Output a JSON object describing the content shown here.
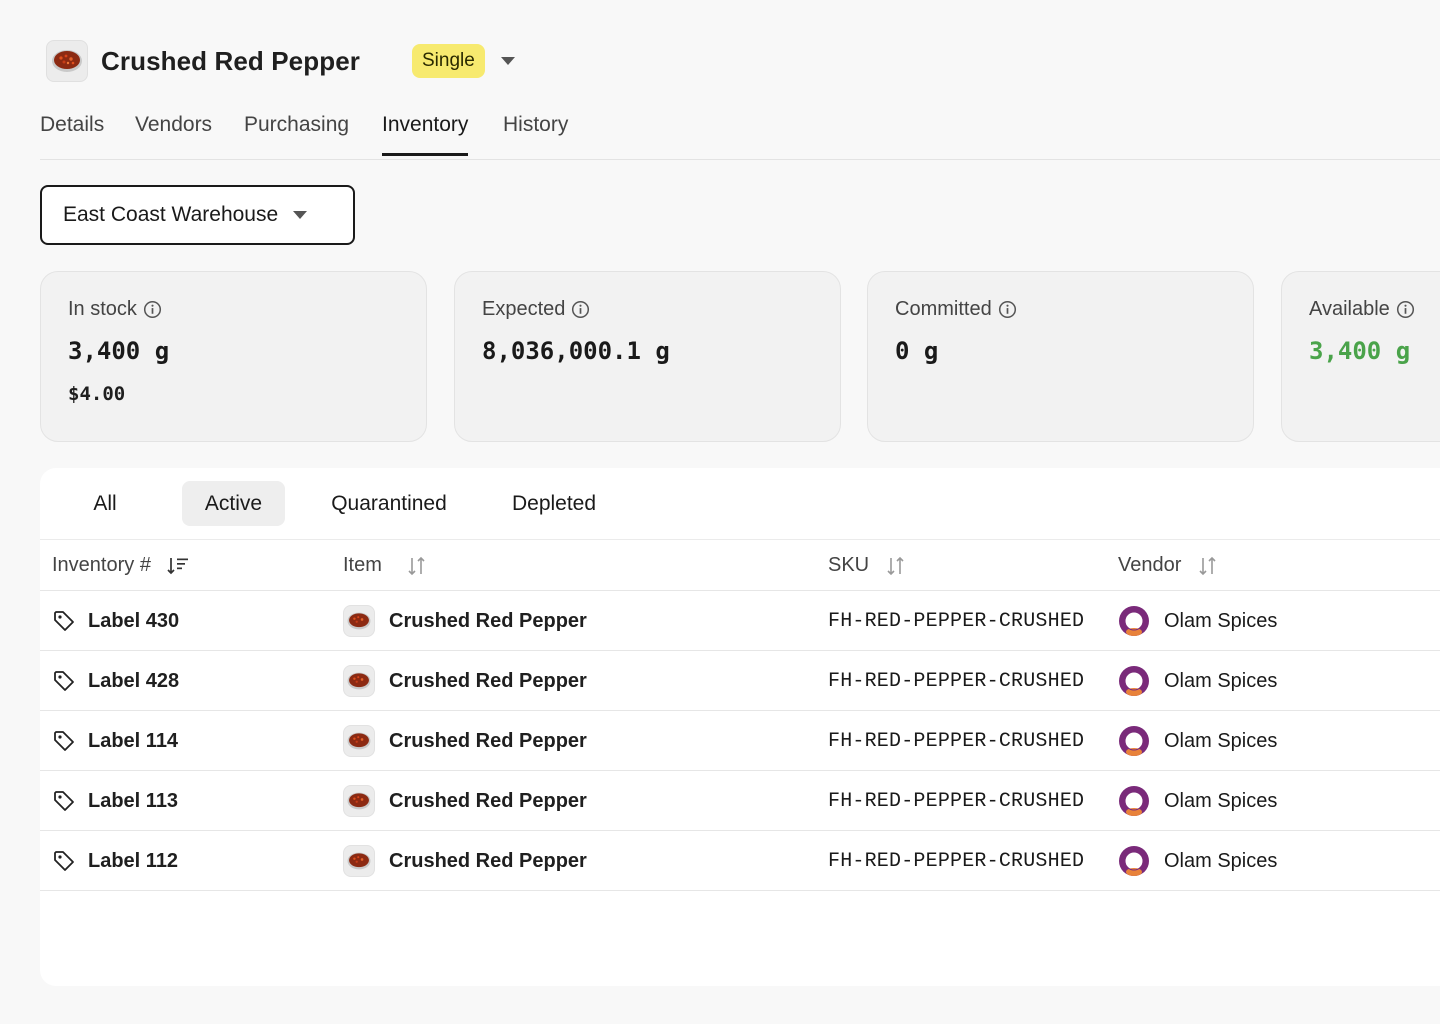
{
  "header": {
    "title": "Crushed Red Pepper",
    "badge": "Single",
    "thumb_icon": "red-pepper-bowl-icon"
  },
  "tabs": [
    {
      "label": "Details",
      "active": false
    },
    {
      "label": "Vendors",
      "active": false
    },
    {
      "label": "Purchasing",
      "active": false
    },
    {
      "label": "Inventory",
      "active": true
    },
    {
      "label": "History",
      "active": false
    }
  ],
  "location": {
    "selected": "East Coast Warehouse"
  },
  "stats": [
    {
      "label": "In stock",
      "value": "3,400 g",
      "sub": "$4.00"
    },
    {
      "label": "Expected",
      "value": "8,036,000.1 g"
    },
    {
      "label": "Committed",
      "value": "0 g"
    },
    {
      "label": "Available",
      "value": "3,400 g",
      "color": "#4aa34a"
    }
  ],
  "filters": [
    {
      "label": "All",
      "active": false
    },
    {
      "label": "Active",
      "active": true
    },
    {
      "label": "Quarantined",
      "active": false
    },
    {
      "label": "Depleted",
      "active": false
    }
  ],
  "columns": {
    "inventory": "Inventory #",
    "item": "Item",
    "sku": "SKU",
    "vendor": "Vendor"
  },
  "rows": [
    {
      "label": "Label 430",
      "item": "Crushed Red Pepper",
      "sku": "FH-RED-PEPPER-CRUSHED",
      "vendor": "Olam Spices"
    },
    {
      "label": "Label 428",
      "item": "Crushed Red Pepper",
      "sku": "FH-RED-PEPPER-CRUSHED",
      "vendor": "Olam Spices"
    },
    {
      "label": "Label 114",
      "item": "Crushed Red Pepper",
      "sku": "FH-RED-PEPPER-CRUSHED",
      "vendor": "Olam Spices"
    },
    {
      "label": "Label 113",
      "item": "Crushed Red Pepper",
      "sku": "FH-RED-PEPPER-CRUSHED",
      "vendor": "Olam Spices"
    },
    {
      "label": "Label 112",
      "item": "Crushed Red Pepper",
      "sku": "FH-RED-PEPPER-CRUSHED",
      "vendor": "Olam Spices"
    }
  ],
  "colors": {
    "badge": "#f7ea6f",
    "available": "#4aa34a",
    "vendor_avatar": "#7a2a7a"
  }
}
